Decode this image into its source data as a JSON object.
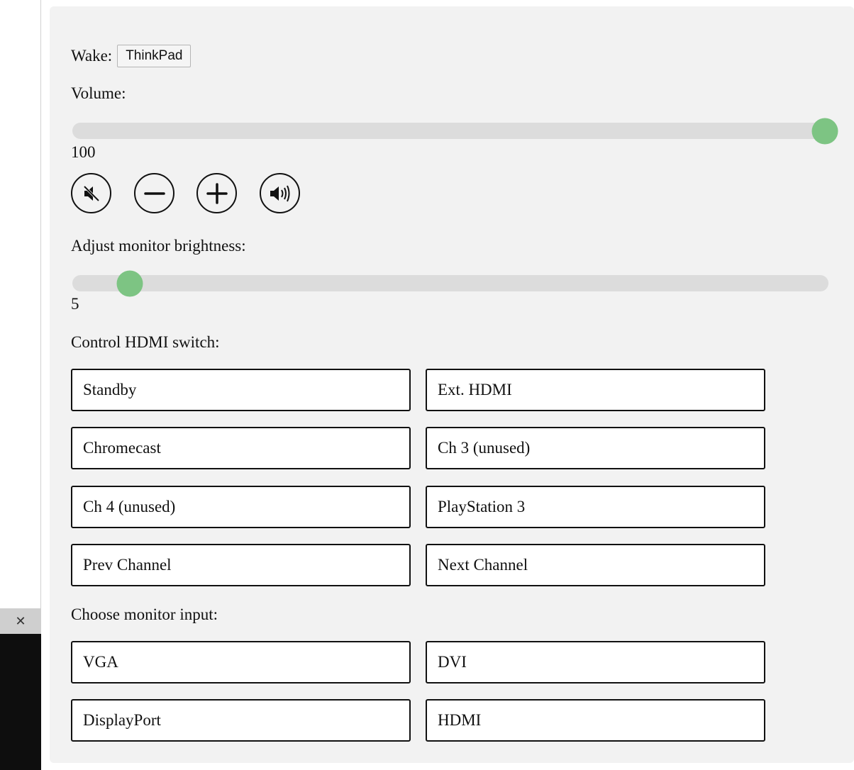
{
  "sidebar": {
    "close_glyph": "✕"
  },
  "wake": {
    "label": "Wake:",
    "button_label": "ThinkPad"
  },
  "volume": {
    "label": "Volume:",
    "value": "100",
    "level_percent": 100,
    "buttons": [
      {
        "name": "mute-button",
        "icon": "speaker-muted-icon"
      },
      {
        "name": "volume-down-button",
        "icon": "minus-icon"
      },
      {
        "name": "volume-up-button",
        "icon": "plus-icon"
      },
      {
        "name": "volume-max-button",
        "icon": "speaker-loud-icon"
      }
    ]
  },
  "brightness": {
    "label": "Adjust monitor brightness:",
    "value": "5",
    "level_percent": 5
  },
  "hdmi": {
    "label": "Control HDMI switch:",
    "buttons": [
      "Standby",
      "Ext. HDMI",
      "Chromecast",
      "Ch 3 (unused)",
      "Ch 4 (unused)",
      "PlayStation 3",
      "Prev Channel",
      "Next Channel"
    ]
  },
  "monitor_input": {
    "label": "Choose monitor input:",
    "buttons": [
      "VGA",
      "DVI",
      "DisplayPort",
      "HDMI"
    ]
  },
  "colors": {
    "panel_bg": "#f2f2f2",
    "slider_track": "#dcdcdc",
    "slider_thumb": "#7dc483",
    "button_border": "#111111"
  }
}
